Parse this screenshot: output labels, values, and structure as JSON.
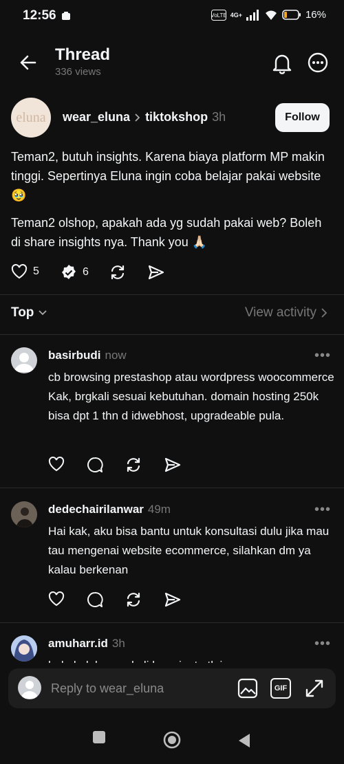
{
  "status": {
    "time": "12:56",
    "network": "4G+",
    "battery": "16%"
  },
  "header": {
    "title": "Thread",
    "views": "336 views"
  },
  "post": {
    "author": "wear_eluna",
    "avatar_text": "eluna",
    "community": "tiktokshop",
    "time": "3h",
    "follow_label": "Follow",
    "paragraph1": "Teman2, butuh insights. Karena biaya platform MP makin tinggi. Sepertinya Eluna ingin coba belajar pakai website 🥹",
    "paragraph2": "Teman2 olshop, apakah ada yg sudah pakai web? Boleh di share insights nya. Thank you 🙏🏻",
    "likes": "5",
    "replies": "6"
  },
  "sort": {
    "label": "Top",
    "view_activity": "View activity"
  },
  "comments": [
    {
      "user": "basirbudi",
      "time": "now",
      "text": "cb browsing prestashop atau wordpress woocommerce Kak, brgkali sesuai kebutuhan. domain hosting 250k bisa dpt 1 thn d idwebhost, upgradeable pula."
    },
    {
      "user": "dedechairilanwar",
      "time": "49m",
      "text": "Hai kak, aku bisa bantu untuk konsultasi dulu jika mau tau mengenai website ecommerce, silahkan dm ya kalau berkenan"
    },
    {
      "user": "amuharr.id",
      "time": "3h",
      "text": "halo kak barangkali berminat utk jasa"
    }
  ],
  "reply": {
    "placeholder": "Reply to wear_eluna",
    "gif_label": "GIF"
  },
  "colors": {
    "background": "#101010",
    "text": "#f3f5f7",
    "muted": "#777777"
  }
}
